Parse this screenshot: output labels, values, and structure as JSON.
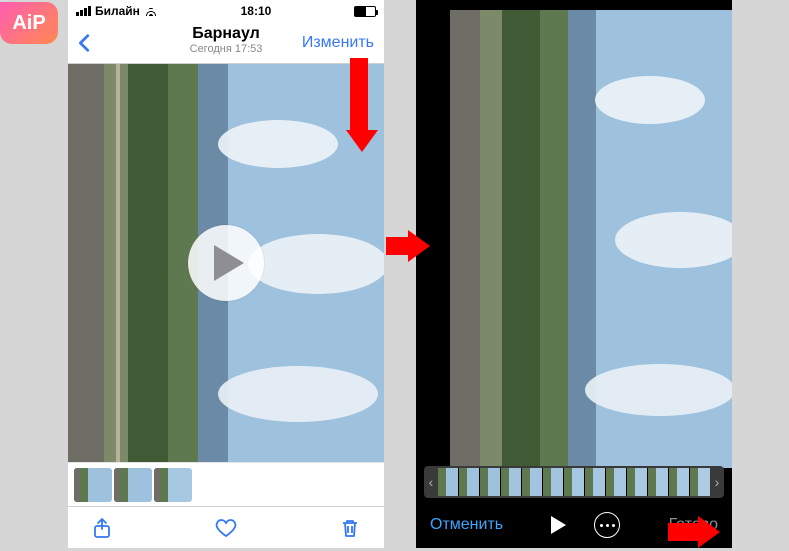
{
  "badge": {
    "text": "AiP"
  },
  "statusbar": {
    "carrier": "Билайн",
    "time": "18:10"
  },
  "navbar": {
    "title": "Барнаул",
    "subtitle": "Сегодня 17:53",
    "edit": "Изменить"
  },
  "editor": {
    "cancel": "Отменить",
    "done": "Готово"
  }
}
